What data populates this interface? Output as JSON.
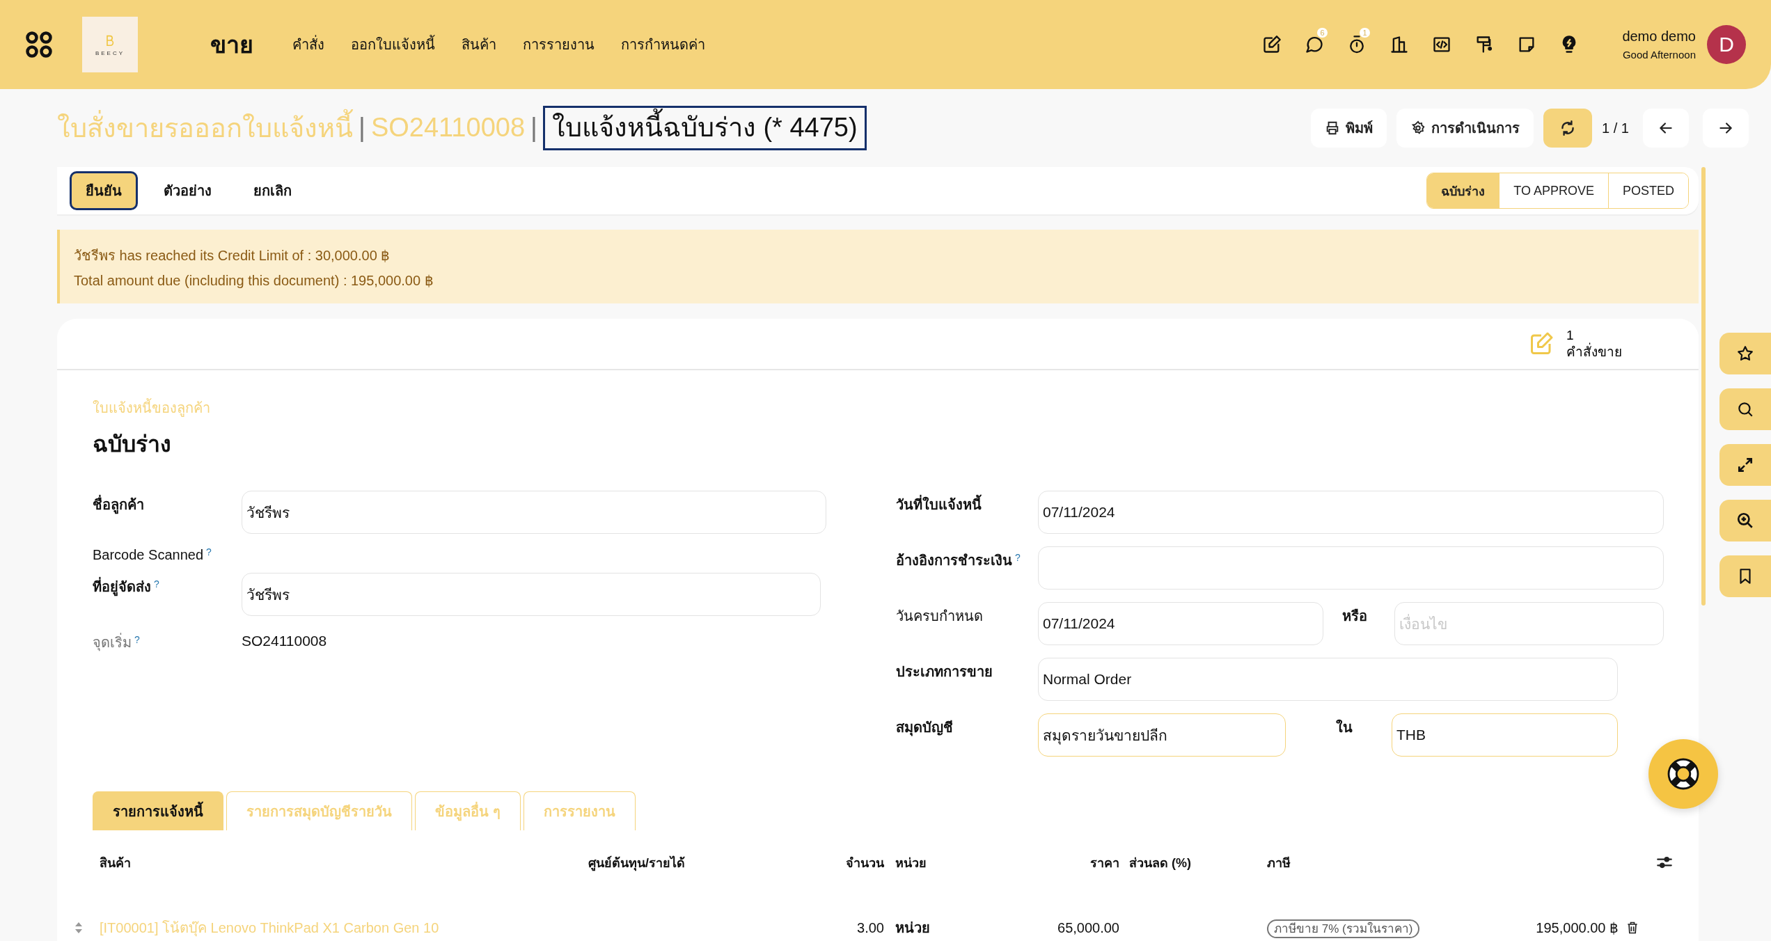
{
  "topbar": {
    "app": "ขาย",
    "logo": "BEECY",
    "menu": [
      "คำสั่ง",
      "ออกใบแจ้งหนี้",
      "สินค้า",
      "การรายงาน",
      "การกำหนดค่า"
    ],
    "tools": [
      {
        "kind": "edit"
      },
      {
        "kind": "chat",
        "badge": "6"
      },
      {
        "kind": "timer",
        "badge": "1"
      },
      {
        "kind": "building"
      },
      {
        "kind": "code"
      },
      {
        "kind": "paint"
      },
      {
        "kind": "note"
      },
      {
        "kind": "bulb"
      }
    ],
    "user": {
      "name": "demo demo",
      "greeting": "Good Afternoon",
      "initial": "D"
    }
  },
  "header": {
    "breadcrumbs": [
      {
        "text": "ใบสั่งขายรอออกใบแจ้งหนี้",
        "separator": "|"
      },
      {
        "text": "SO24110008",
        "separator": "|"
      }
    ],
    "title": "ใบแจ้งหนี้ฉบับร่าง (* 4475)",
    "title_outlined": true,
    "print": "พิมพ์",
    "action": "การดำเนินการ",
    "pager": "1 / 1"
  },
  "buttons": [
    {
      "label": "ยืนยัน",
      "primary": true,
      "outlined": true
    },
    {
      "label": "ตัวอย่าง",
      "primary": false,
      "outlined": false
    },
    {
      "label": "ยกเลิก",
      "primary": false,
      "outlined": false
    }
  ],
  "statuses": [
    {
      "label": "ฉบับร่าง",
      "selected": true
    },
    {
      "label": "TO APPROVE",
      "selected": false
    },
    {
      "label": "POSTED",
      "selected": false
    }
  ],
  "alert": [
    "วัชรีพร has reached its Credit Limit of : 30,000.00 ฿",
    "Total amount due (including this document) : 195,000.00 ฿"
  ],
  "smart_button": {
    "count": "1",
    "label": "คำสั่งขาย"
  },
  "form": {
    "subtitle": "ใบแจ้งหนี้ของลูกค้า",
    "name": "ฉบับร่าง",
    "left_fields": [
      {
        "kind": "input",
        "label": "ชื่อลูกค้า",
        "required": true,
        "value": "วัชรีพร"
      },
      {
        "kind": "label",
        "label": "Barcode Scanned",
        "required": false,
        "help": "?"
      },
      {
        "kind": "input",
        "label": "ที่อยู่จัดส่ง",
        "required": true,
        "help": "?",
        "value": "วัชรีพร"
      },
      {
        "kind": "text",
        "label": "จุดเริ่ม",
        "required": false,
        "muted": true,
        "help": "?",
        "value": "SO24110008"
      }
    ],
    "right_fields": [
      {
        "kind": "full",
        "label": "วันที่ใบแจ้งหนี้",
        "required": true,
        "emphasis": false,
        "value": "07/11/2024"
      },
      {
        "kind": "full",
        "label": "อ้างอิงการชำระเงิน",
        "required": true,
        "emphasis": false,
        "help": "?"
      },
      {
        "kind": "pair",
        "label": "วันครบกำหนด",
        "required": false,
        "emphasis": false,
        "value": "07/11/2024",
        "second": {
          "label": "หรือ",
          "placeholder": "เงื่อนไข"
        }
      },
      {
        "kind": "short",
        "label": "ประเภทการขาย",
        "required": true,
        "emphasis": false,
        "value": "Normal Order"
      },
      {
        "kind": "pair",
        "label": "สมุดบัญชี",
        "required": true,
        "emphasis": true,
        "value": "สมุดรายวันขายปลีก",
        "second": {
          "label": "ใน",
          "value": "THB"
        }
      }
    ]
  },
  "tabs": [
    {
      "label": "รายการแจ้งหนี้",
      "selected": true
    },
    {
      "label": "รายการสมุดบัญชีรายวัน",
      "selected": false
    },
    {
      "label": "ข้อมูลอื่น ๆ",
      "selected": false
    },
    {
      "label": "การรายงาน",
      "selected": false
    }
  ],
  "table": {
    "columns": [
      "สินค้า",
      "ศูนย์ต้นทุน/รายได้",
      "จำนวน",
      "หน่วย",
      "ราคา",
      "ส่วนลด (%)",
      "ภาษี"
    ],
    "rows": [
      {
        "product": "[IT00001] โน้ตบุ๊ค Lenovo ThinkPad X1 Carbon Gen 10",
        "quantity": "3.00",
        "unit": "หน่วย",
        "price": "65,000.00",
        "taxes": [
          "ภาษีขาย 7% (รวมในราคา)"
        ],
        "subtotal": "195,000.00 ฿"
      }
    ]
  }
}
